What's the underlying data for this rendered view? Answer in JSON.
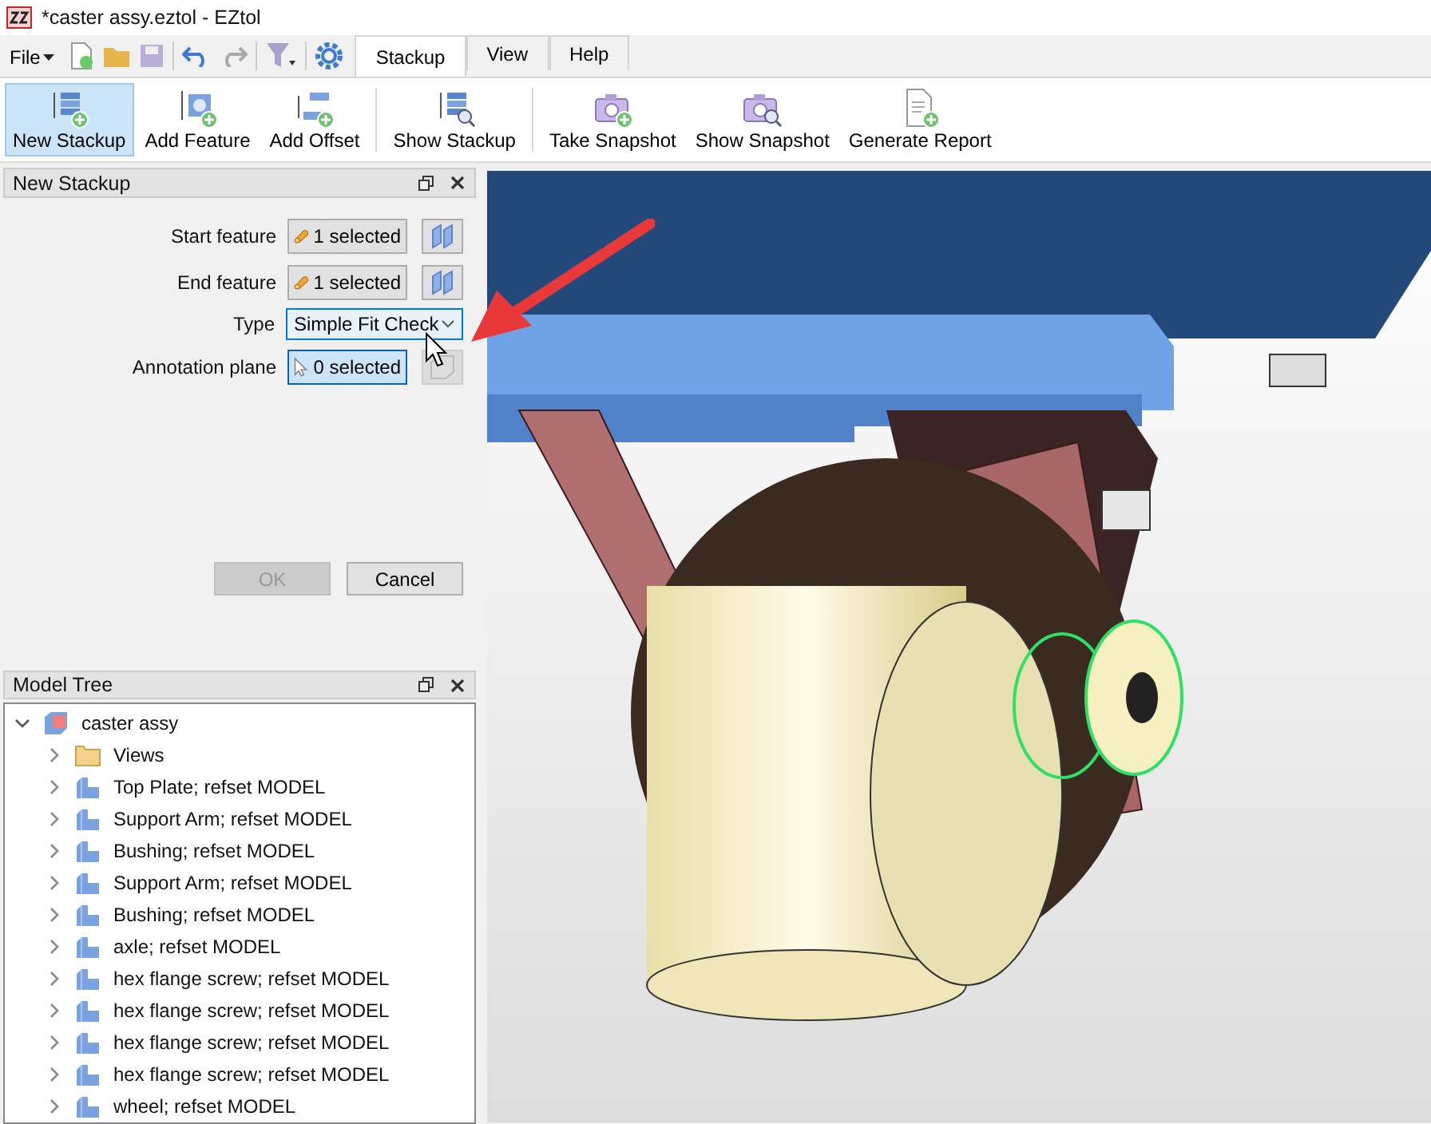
{
  "window": {
    "title": "*caster assy.eztol - EZtol"
  },
  "menu": {
    "file": "File"
  },
  "tabs": [
    {
      "label": "Stackup",
      "selected": true
    },
    {
      "label": "View",
      "selected": false
    },
    {
      "label": "Help",
      "selected": false
    }
  ],
  "ribbon": [
    {
      "buttons": [
        {
          "label": "New Stackup",
          "kind": "stack-add",
          "selected": true
        },
        {
          "label": "Add Feature",
          "kind": "feature-add",
          "selected": false
        },
        {
          "label": "Add Offset",
          "kind": "offset-add",
          "selected": false
        }
      ]
    },
    {
      "buttons": [
        {
          "label": "Show Stackup",
          "kind": "stack-search",
          "selected": false
        }
      ]
    },
    {
      "buttons": [
        {
          "label": "Take Snapshot",
          "kind": "camera-add",
          "selected": false
        },
        {
          "label": "Show Snapshot",
          "kind": "camera-search",
          "selected": false
        },
        {
          "label": "Generate Report",
          "kind": "report-add",
          "selected": false
        }
      ]
    }
  ],
  "new_stackup": {
    "title": "New Stackup",
    "fields": [
      {
        "label": "Start feature",
        "kind": "feature-picker",
        "value": "1 selected",
        "selected": false,
        "side_disabled": false
      },
      {
        "label": "End feature",
        "kind": "feature-picker",
        "value": "1 selected",
        "selected": false,
        "side_disabled": false
      },
      {
        "label": "Type",
        "kind": "dropdown",
        "value": "Simple Fit Check"
      },
      {
        "label": "Annotation plane",
        "kind": "plane-picker",
        "value": "0 selected",
        "selected": true,
        "side_disabled": true
      }
    ],
    "ok": {
      "label": "OK",
      "disabled": true
    },
    "cancel": {
      "label": "Cancel",
      "disabled": false
    }
  },
  "model_tree": {
    "title": "Model Tree",
    "root": {
      "label": "caster assy",
      "expanded": true,
      "children": [
        {
          "label": "Views",
          "kind": "folder",
          "expanded": false
        },
        {
          "label": "Top Plate; refset MODEL",
          "kind": "part",
          "expanded": false
        },
        {
          "label": "Support Arm; refset MODEL",
          "kind": "part",
          "expanded": false
        },
        {
          "label": "Bushing; refset MODEL",
          "kind": "part",
          "expanded": false
        },
        {
          "label": "Support Arm; refset MODEL",
          "kind": "part",
          "expanded": false
        },
        {
          "label": "Bushing; refset MODEL",
          "kind": "part",
          "expanded": false
        },
        {
          "label": "axle; refset MODEL",
          "kind": "part",
          "expanded": false
        },
        {
          "label": "hex flange screw; refset MODEL",
          "kind": "part",
          "expanded": false
        },
        {
          "label": "hex flange screw; refset MODEL",
          "kind": "part",
          "expanded": false
        },
        {
          "label": "hex flange screw; refset MODEL",
          "kind": "part",
          "expanded": false
        },
        {
          "label": "hex flange screw; refset MODEL",
          "kind": "part",
          "expanded": false
        },
        {
          "label": "wheel; refset MODEL",
          "kind": "part",
          "expanded": false
        }
      ]
    }
  }
}
